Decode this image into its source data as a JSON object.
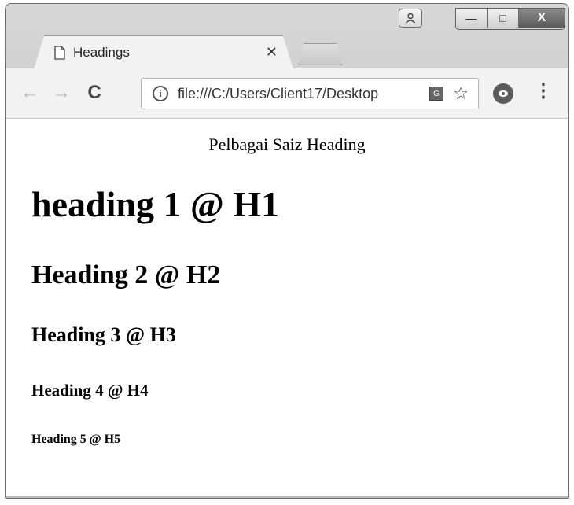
{
  "window": {
    "caption_buttons": {
      "user_icon": "person-icon",
      "minimize_icon": "minimize-icon",
      "maximize_icon": "maximize-icon",
      "close_icon": "close-icon",
      "minimize_glyph": "—",
      "maximize_glyph": "□",
      "close_glyph": "X"
    }
  },
  "tabs": [
    {
      "title": "Headings",
      "icon": "page-icon",
      "close_glyph": "✕"
    }
  ],
  "toolbar": {
    "back_glyph": "←",
    "forward_glyph": "→",
    "reload_glyph": "C",
    "url": "file:///C:/Users/Client17/Desktop",
    "info_glyph": "i",
    "star_glyph": "☆",
    "menu_glyph": "⋮"
  },
  "page": {
    "caption": "Pelbagai Saiz Heading",
    "headings": {
      "h1": "heading 1 @ H1",
      "h2": "Heading 2 @ H2",
      "h3": "Heading 3 @ H3",
      "h4": "Heading 4 @ H4",
      "h5": "Heading 5 @ H5"
    }
  },
  "colors": {
    "chrome_frame": "#c4c4c4",
    "tab_background": "#f2f2f2",
    "page_background": "#ffffff",
    "text": "#000000"
  }
}
